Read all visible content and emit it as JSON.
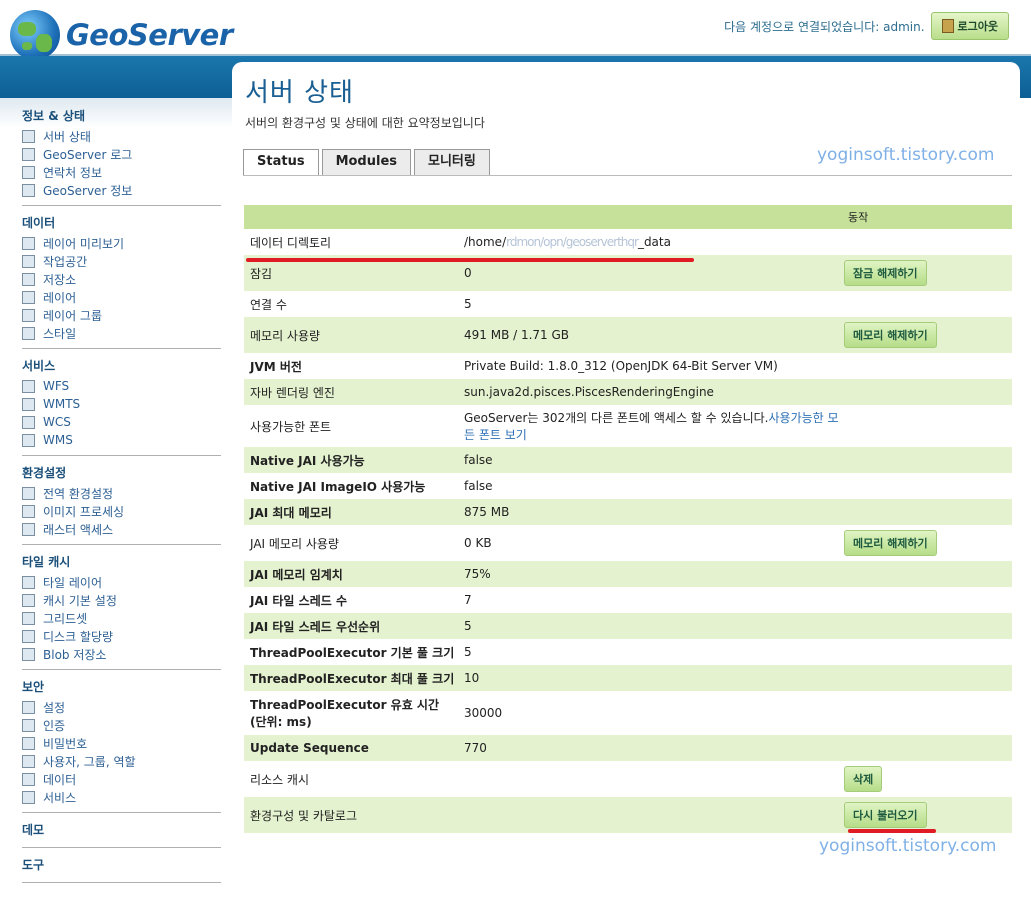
{
  "header": {
    "app_name": "GeoServer",
    "logged_in_text": "다음 계정으로 연결되었습니다: admin.",
    "logout_label": "로그아웃"
  },
  "sidebar": {
    "sections": [
      {
        "title": "정보 & 상태",
        "items": [
          {
            "label": "서버 상태",
            "icon": "warning-icon"
          },
          {
            "label": "GeoServer 로그",
            "icon": "document-icon"
          },
          {
            "label": "연락처 정보",
            "icon": "contact-card-icon"
          },
          {
            "label": "GeoServer 정보",
            "icon": "info-icon"
          }
        ]
      },
      {
        "title": "데이터",
        "items": [
          {
            "label": "레이어 미리보기",
            "icon": "map-preview-icon"
          },
          {
            "label": "작업공간",
            "icon": "folder-icon"
          },
          {
            "label": "저장소",
            "icon": "database-icon"
          },
          {
            "label": "레이어",
            "icon": "layer-icon"
          },
          {
            "label": "레이어 그룹",
            "icon": "layer-group-icon"
          },
          {
            "label": "스타일",
            "icon": "palette-icon"
          }
        ]
      },
      {
        "title": "서비스",
        "items": [
          {
            "label": "WFS",
            "icon": "wfs-service-icon"
          },
          {
            "label": "WMTS",
            "icon": "wmts-service-icon"
          },
          {
            "label": "WCS",
            "icon": "wcs-service-icon"
          },
          {
            "label": "WMS",
            "icon": "wms-service-icon"
          }
        ]
      },
      {
        "title": "환경설정",
        "items": [
          {
            "label": "전역 환경설정",
            "icon": "global-settings-icon"
          },
          {
            "label": "이미지 프로세싱",
            "icon": "image-processing-icon"
          },
          {
            "label": "래스터 액세스",
            "icon": "raster-access-icon"
          }
        ]
      },
      {
        "title": "타일 캐시",
        "items": [
          {
            "label": "타일 레이어",
            "icon": "tile-layer-icon"
          },
          {
            "label": "캐시 기본 설정",
            "icon": "globe-icon"
          },
          {
            "label": "그리드셋",
            "icon": "gridset-icon"
          },
          {
            "label": "디스크 할당량",
            "icon": "disk-icon"
          },
          {
            "label": "Blob 저장소",
            "icon": "blob-store-icon"
          }
        ]
      },
      {
        "title": "보안",
        "items": [
          {
            "label": "설정",
            "icon": "wrench-icon"
          },
          {
            "label": "인증",
            "icon": "shield-icon"
          },
          {
            "label": "비밀번호",
            "icon": "lock-icon"
          },
          {
            "label": "사용자, 그룹, 역할",
            "icon": "users-icon"
          },
          {
            "label": "데이터",
            "icon": "data-security-icon"
          },
          {
            "label": "서비스",
            "icon": "service-security-icon"
          }
        ]
      },
      {
        "title": "데모",
        "items": []
      },
      {
        "title": "도구",
        "items": []
      }
    ]
  },
  "main": {
    "title": "서버 상태",
    "description": "서버의 환경구성 및 상태에 대한 요약정보입니다",
    "tabs": [
      "Status",
      "Modules",
      "모니터링"
    ],
    "watermark": "yoginsoft.tistory.com",
    "table": {
      "action_header": "동작",
      "rows": [
        {
          "label": "데이터 디렉토리",
          "value_prefix": "/home/",
          "value_blurred": "rdmon/opn/geoserverthqr",
          "value_suffix": "_data",
          "action": ""
        },
        {
          "label": "잠김",
          "value": "0",
          "action": "잠금 해제하기"
        },
        {
          "label": "연결 수",
          "value": "5",
          "action": ""
        },
        {
          "label": "메모리 사용량",
          "value": "491 MB / 1.71 GB",
          "action": "메모리 해제하기"
        },
        {
          "label": "JVM 버전",
          "value": "Private Build: 1.8.0_312 (OpenJDK 64-Bit Server VM)",
          "action": ""
        },
        {
          "label": "자바 렌더링 엔진",
          "value": "sun.java2d.pisces.PiscesRenderingEngine",
          "action": ""
        },
        {
          "label": "사용가능한 폰트",
          "value_text": "GeoServer는 302개의 다른 폰트에 액세스 할 수 있습니다.",
          "value_link": "사용가능한 모든 폰트 보기",
          "action": ""
        },
        {
          "label": "Native JAI 사용가능",
          "value": "false",
          "action": ""
        },
        {
          "label": "Native JAI ImageIO 사용가능",
          "value": "false",
          "action": ""
        },
        {
          "label": "JAI 최대 메모리",
          "value": "875 MB",
          "action": ""
        },
        {
          "label": "JAI 메모리 사용량",
          "value": "0 KB",
          "action": "메모리 해제하기"
        },
        {
          "label": "JAI 메모리 임계치",
          "value": "75%",
          "action": ""
        },
        {
          "label": "JAI 타일 스레드 수",
          "value": "7",
          "action": ""
        },
        {
          "label": "JAI 타일 스레드 우선순위",
          "value": "5",
          "action": ""
        },
        {
          "label": "ThreadPoolExecutor 기본 풀 크기",
          "value": "5",
          "action": ""
        },
        {
          "label": "ThreadPoolExecutor 최대 풀 크기",
          "value": "10",
          "action": ""
        },
        {
          "label": "ThreadPoolExecutor 유효 시간 (단위: ms)",
          "value": "30000",
          "action": ""
        },
        {
          "label": "Update Sequence",
          "value": "770",
          "action": ""
        },
        {
          "label": "리소스 캐시",
          "value": "",
          "action": "삭제"
        },
        {
          "label": "환경구성 및 카탈로그",
          "value": "",
          "action": "다시 불러오기"
        }
      ]
    }
  }
}
